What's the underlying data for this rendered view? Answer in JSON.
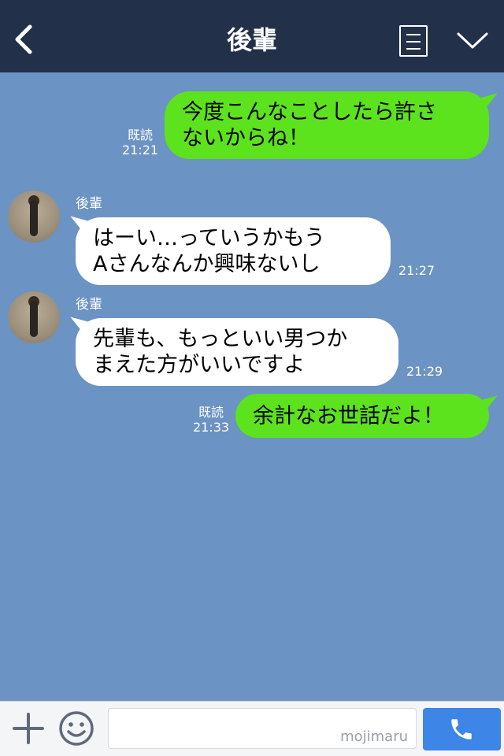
{
  "header": {
    "title": "後輩"
  },
  "messages": [
    {
      "side": "me",
      "lines": [
        "今度こんなことしたら許さ",
        "ないからね！"
      ],
      "read": "既読",
      "time": "21:21"
    },
    {
      "side": "them",
      "sender": "後輩",
      "lines": [
        "はーい…っていうかもう",
        "Aさんなんか興味ないし"
      ],
      "time": "21:27"
    },
    {
      "side": "them",
      "sender": "後輩",
      "lines": [
        "先輩も、もっといい男つか",
        "まえた方がいいですよ"
      ],
      "time": "21:29"
    },
    {
      "side": "me",
      "lines": [
        "余計なお世話だよ！"
      ],
      "read": "既読",
      "time": "21:33"
    }
  ],
  "input": {
    "watermark": "mojimaru"
  },
  "colors": {
    "header": "#22304a",
    "background": "#6b93c4",
    "my_bubble": "#5de21e",
    "their_bubble": "#ffffff",
    "call_button": "#3d86e8"
  },
  "icons": {
    "back": "chevron-left-icon",
    "notes": "notes-icon",
    "menu": "chevron-down-icon",
    "add": "plus-icon",
    "emoji": "smiley-icon",
    "call": "phone-icon"
  }
}
